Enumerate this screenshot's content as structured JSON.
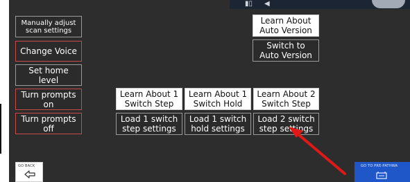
{
  "left_buttons": [
    {
      "label": "Manually adjust\nscan settings"
    },
    {
      "label": "Change Voice"
    },
    {
      "label": "Set home\nlevel"
    },
    {
      "label": "Turn prompts\non"
    },
    {
      "label": "Turn prompts\noff"
    }
  ],
  "right_buttons": {
    "learn_auto": "Learn About\nAuto Version",
    "switch_auto": "Switch to\nAuto Version"
  },
  "grid_buttons": {
    "learn_1_step": "Learn About 1\nSwitch Step",
    "learn_1_hold": "Learn About 1\nSwitch Hold",
    "learn_2_step": "Learn About 2\nSwitch Step",
    "load_1_step": "Load 1 switch\nstep settings",
    "load_1_hold": "Load 1 switch\nhold settings",
    "load_2_step": "Load 2 switch\nstep settings"
  },
  "footer": {
    "go_back": "GO BACK",
    "pre_pathway": "GO TO PRE-PATHWA"
  },
  "colors": {
    "background": "#2d2d2d",
    "annotation_arrow": "#e01818",
    "pre_pathway_button": "#1f57c8"
  }
}
